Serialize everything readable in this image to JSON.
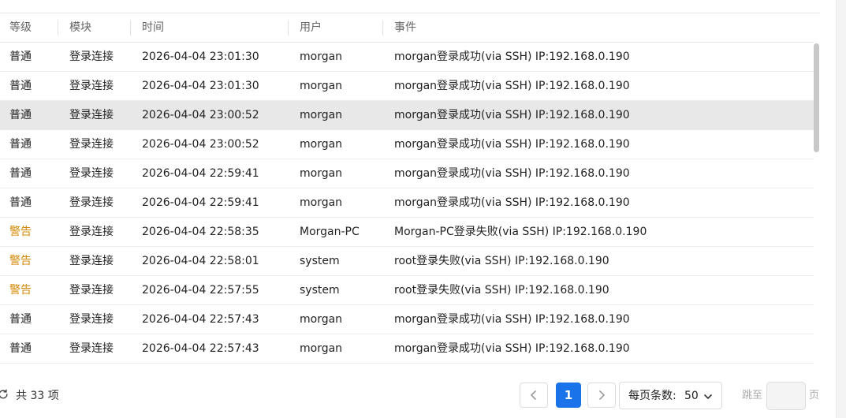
{
  "table": {
    "columns": [
      "等级",
      "模块",
      "时间",
      "用户",
      "事件"
    ],
    "rows": [
      {
        "level": "普通",
        "level_color": "#222222",
        "module": "登录连接",
        "time": "2026-04-04 23:01:30",
        "user": "morgan",
        "event": "morgan登录成功(via SSH) IP:192.168.0.190"
      },
      {
        "level": "普通",
        "level_color": "#222222",
        "module": "登录连接",
        "time": "2026-04-04 23:01:30",
        "user": "morgan",
        "event": "morgan登录成功(via SSH) IP:192.168.0.190"
      },
      {
        "level": "普通",
        "level_color": "#222222",
        "module": "登录连接",
        "time": "2026-04-04 23:00:52",
        "user": "morgan",
        "event": "morgan登录成功(via SSH) IP:192.168.0.190",
        "selected": true
      },
      {
        "level": "普通",
        "level_color": "#222222",
        "module": "登录连接",
        "time": "2026-04-04 23:00:52",
        "user": "morgan",
        "event": "morgan登录成功(via SSH) IP:192.168.0.190"
      },
      {
        "level": "普通",
        "level_color": "#222222",
        "module": "登录连接",
        "time": "2026-04-04 22:59:41",
        "user": "morgan",
        "event": "morgan登录成功(via SSH) IP:192.168.0.190"
      },
      {
        "level": "普通",
        "level_color": "#222222",
        "module": "登录连接",
        "time": "2026-04-04 22:59:41",
        "user": "morgan",
        "event": "morgan登录成功(via SSH) IP:192.168.0.190"
      },
      {
        "level": "警告",
        "level_color": "#d48806",
        "module": "登录连接",
        "time": "2026-04-04 22:58:35",
        "user": "Morgan-PC",
        "event": "Morgan-PC登录失败(via SSH) IP:192.168.0.190"
      },
      {
        "level": "警告",
        "level_color": "#d48806",
        "module": "登录连接",
        "time": "2026-04-04 22:58:01",
        "user": "system",
        "event": "root登录失败(via SSH) IP:192.168.0.190"
      },
      {
        "level": "警告",
        "level_color": "#d48806",
        "module": "登录连接",
        "time": "2026-04-04 22:57:55",
        "user": "system",
        "event": "root登录失败(via SSH) IP:192.168.0.190"
      },
      {
        "level": "普通",
        "level_color": "#222222",
        "module": "登录连接",
        "time": "2026-04-04 22:57:43",
        "user": "morgan",
        "event": "morgan登录成功(via SSH) IP:192.168.0.190"
      },
      {
        "level": "普通",
        "level_color": "#222222",
        "module": "登录连接",
        "time": "2026-04-04 22:57:43",
        "user": "morgan",
        "event": "morgan登录成功(via SSH) IP:192.168.0.190"
      }
    ]
  },
  "footer": {
    "refresh_icon": "refresh-icon",
    "total_text": "共 33 项",
    "current_page": "1",
    "prev_icon": "chevron-left-icon",
    "next_icon": "chevron-right-icon",
    "page_size_label": "每页条数:",
    "page_size_value": "50",
    "page_size_icon": "chevron-down-icon",
    "jump_label": "跳至",
    "jump_value": "",
    "page_unit": "页"
  },
  "colors": {
    "accent": "#1a73e8",
    "warn": "#d48806",
    "selected_row": "#e8e8e8"
  }
}
